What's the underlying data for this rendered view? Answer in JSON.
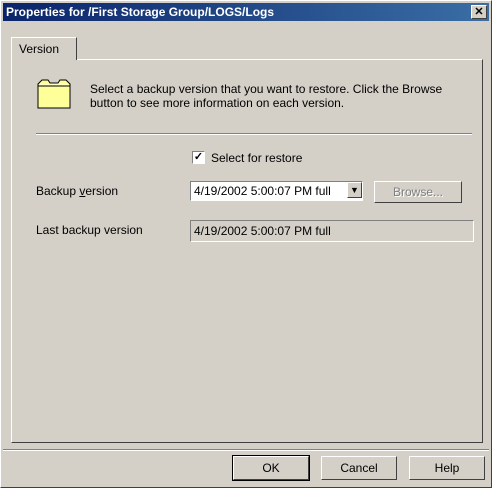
{
  "window": {
    "title": "Properties for /First Storage Group/LOGS/Logs",
    "close_glyph": "✕"
  },
  "tabs": [
    {
      "label": "Version",
      "active": true
    }
  ],
  "description": "Select a backup version that you want to restore. Click the Browse button to see more information on each version.",
  "select_for_restore": {
    "label": "Select for restore",
    "checked": true,
    "check_glyph": "✓"
  },
  "backup_version": {
    "label_before": "Backup ",
    "label_underlined": "v",
    "label_after": "ersion",
    "value": "4/19/2002 5:00:07 PM full",
    "dropdown_glyph": "▼"
  },
  "browse_button": {
    "label": "Browse...",
    "enabled": false
  },
  "last_backup_version": {
    "label": "Last backup version",
    "value": "4/19/2002 5:00:07 PM full"
  },
  "buttons": {
    "ok": "OK",
    "cancel": "Cancel",
    "help": "Help"
  },
  "colors": {
    "title_bar": "#0a246a",
    "face": "#d4d0c8",
    "folder_fill": "#ffff99",
    "disabled_text": "#808080"
  },
  "icons": [
    "folder-icon",
    "checkbox-check-icon",
    "dropdown-arrow-icon",
    "close-icon"
  ]
}
